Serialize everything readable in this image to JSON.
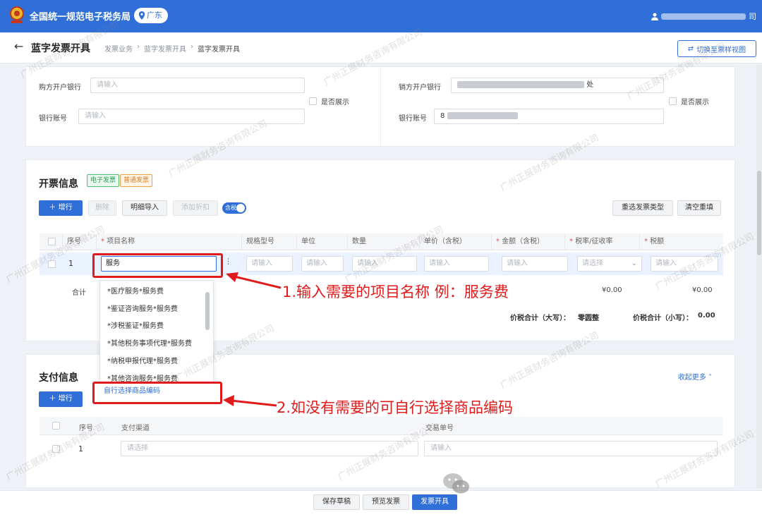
{
  "topbar": {
    "title": "全国统一规范电子税务局",
    "region": "广东",
    "user_suffix": "司"
  },
  "page": {
    "title": "蓝字发票开具",
    "breadcrumb": [
      "发票业务",
      "蓝字发票开具",
      "蓝字发票开具"
    ],
    "switch_button": "切换至票样视图"
  },
  "buyer": {
    "bank_label": "购方开户银行",
    "bank_placeholder": "请输入",
    "account_label": "银行账号",
    "account_placeholder": "请输入",
    "show_label": "是否展示"
  },
  "seller": {
    "bank_label": "销方开户银行",
    "bank_value_tail": "处",
    "account_label": "银行账号",
    "account_value_head": "8",
    "show_label": "是否展示"
  },
  "invoice": {
    "title": "开票信息",
    "tag_electronic": "电子发票",
    "tag_normal": "普通发票",
    "buttons": {
      "add_row": "增行",
      "delete": "删除",
      "import": "明细导入",
      "discount": "添加折扣",
      "tax_toggle": "含税",
      "reselect_type": "重选发票类型",
      "clear": "清空重填"
    },
    "columns": [
      "序号",
      "项目名称",
      "规格型号",
      "单位",
      "数量",
      "单价（含税）",
      "金额（含税）",
      "税率/征收率",
      "税额"
    ],
    "required_mark": "*",
    "row": {
      "index": "1",
      "item_name": "服务",
      "spec_placeholder": "请输入",
      "unit_placeholder": "请输入",
      "qty_placeholder": "请输入",
      "price_placeholder": "请输入",
      "amount_placeholder": "请输入",
      "rate_placeholder": "请选择",
      "tax_placeholder": "请输入"
    },
    "total_label": "合计",
    "total_amount": "¥0.00",
    "total_tax": "¥0.00",
    "sum_upper_label": "价税合计（大写）：",
    "sum_upper_value": "零圆整",
    "sum_lower_label": "价税合计（小写）：",
    "sum_lower_value": "0.00"
  },
  "dropdown": {
    "items": [
      "*医疗服务*服务费",
      "*鉴证咨询服务*服务费",
      "*涉税鉴证*服务费",
      "*其他税务事项代理*服务费",
      "*纳税申报代理*服务费",
      "*其他咨询服务*服务费"
    ],
    "footer": "自行选择商品编码"
  },
  "payment": {
    "title": "支付信息",
    "collapse": "收起更多",
    "add_row": "增行",
    "columns": [
      "序号",
      "支付渠道",
      "交易单号"
    ],
    "row": {
      "index": "1",
      "channel_placeholder": "请选择",
      "txn_placeholder": "请输入"
    }
  },
  "bottom": {
    "save_draft": "保存草稿",
    "preview": "预览发票",
    "issue": "发票开具"
  },
  "annotations": {
    "step1": "1.输入需要的项目名称 例：服务费",
    "step2": "2.如没有需要的可自行选择商品编码"
  },
  "watermark": "广州正展财务咨询有限公司",
  "colors": {
    "brand_blue": "#2f6fd7",
    "annotation_red": "#e11b1b"
  }
}
